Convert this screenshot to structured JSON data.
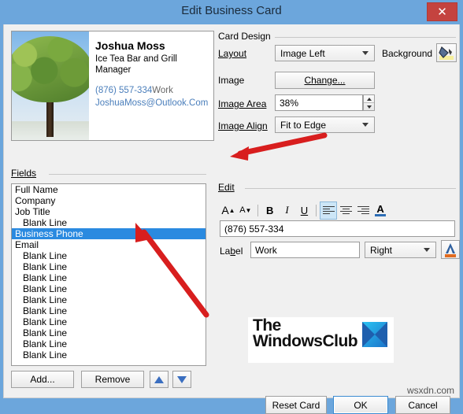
{
  "window": {
    "title": "Edit Business Card",
    "close_label": "✕",
    "titlebar_color": "#6ca6dc",
    "close_color": "#c4433f"
  },
  "preview": {
    "name": "Joshua Moss",
    "company": "Ice Tea Bar and Grill",
    "job_title": "Manager",
    "phone": "(876) 557-334",
    "phone_label": "Work",
    "email": "JoshuaMoss@Outlook.Com",
    "image_alt": "tree-photo",
    "link_color": "#4a7ebb"
  },
  "card_design": {
    "group_label": "Card Design",
    "layout_label": "Layout",
    "layout_value": "Image Left",
    "background_label": "Background",
    "background_icon": "paint-bucket-icon",
    "image_label": "Image",
    "change_button": "Change...",
    "image_area_label": "Image Area",
    "image_area_value": "38%",
    "image_align_label": "Image Align",
    "image_align_value": "Fit to Edge"
  },
  "fields": {
    "group_label": "Fields",
    "items": [
      {
        "label": "Full Name",
        "indent": false,
        "selected": false
      },
      {
        "label": "Company",
        "indent": false,
        "selected": false
      },
      {
        "label": "Job Title",
        "indent": false,
        "selected": false
      },
      {
        "label": "Blank Line",
        "indent": true,
        "selected": false
      },
      {
        "label": "Business Phone",
        "indent": false,
        "selected": true
      },
      {
        "label": "Email",
        "indent": false,
        "selected": false
      },
      {
        "label": "Blank Line",
        "indent": true,
        "selected": false
      },
      {
        "label": "Blank Line",
        "indent": true,
        "selected": false
      },
      {
        "label": "Blank Line",
        "indent": true,
        "selected": false
      },
      {
        "label": "Blank Line",
        "indent": true,
        "selected": false
      },
      {
        "label": "Blank Line",
        "indent": true,
        "selected": false
      },
      {
        "label": "Blank Line",
        "indent": true,
        "selected": false
      },
      {
        "label": "Blank Line",
        "indent": true,
        "selected": false
      },
      {
        "label": "Blank Line",
        "indent": true,
        "selected": false
      },
      {
        "label": "Blank Line",
        "indent": true,
        "selected": false
      },
      {
        "label": "Blank Line",
        "indent": true,
        "selected": false
      }
    ],
    "selection_color": "#2a8ae0",
    "add_button": "Add...",
    "remove_button": "Remove",
    "move_up_icon": "arrow-up-icon",
    "move_down_icon": "arrow-down-icon"
  },
  "edit": {
    "group_label": "Edit",
    "toolbar": [
      {
        "name": "increase-font-size-icon",
        "glyph": "A",
        "active": false
      },
      {
        "name": "decrease-font-size-icon",
        "glyph": "A",
        "active": false
      },
      {
        "name": "bold-icon",
        "glyph": "B",
        "active": false
      },
      {
        "name": "italic-icon",
        "glyph": "I",
        "active": false
      },
      {
        "name": "underline-icon",
        "glyph": "U",
        "active": false
      },
      {
        "name": "align-left-icon",
        "glyph": "",
        "active": true
      },
      {
        "name": "align-center-icon",
        "glyph": "",
        "active": false
      },
      {
        "name": "align-right-icon",
        "glyph": "",
        "active": false
      },
      {
        "name": "font-color-icon",
        "glyph": "A",
        "active": false
      }
    ],
    "value": "(876) 557-334",
    "label_label": "Label",
    "label_value": "Work",
    "label_position": "Right",
    "label_color_icon": "font-color-icon"
  },
  "footer": {
    "reset_card": "Reset Card",
    "ok": "OK",
    "cancel": "Cancel"
  },
  "logo": {
    "line1": "The",
    "line2": "WindowsClub",
    "mark": "windowsclub-logo-icon"
  },
  "watermark": "wsxdn.com"
}
